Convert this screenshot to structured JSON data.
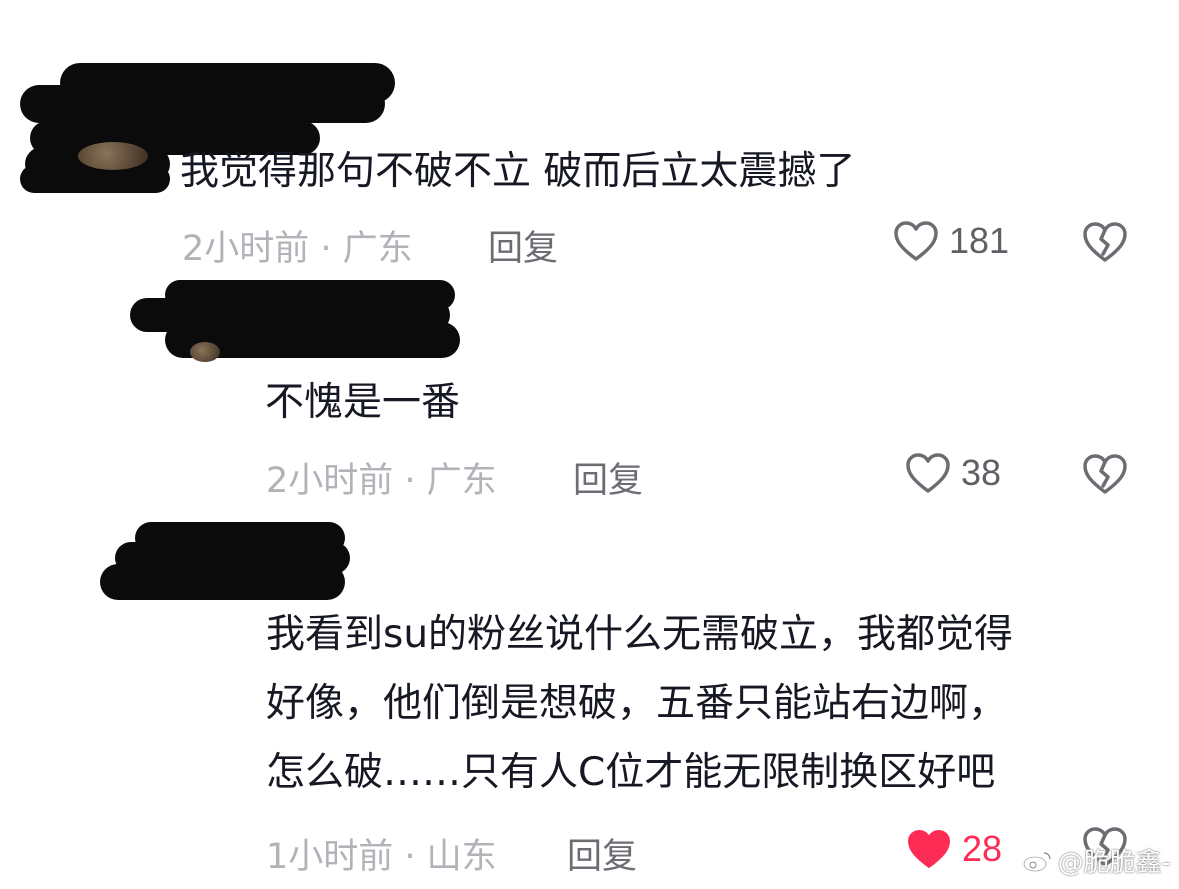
{
  "comments": [
    {
      "text_lines": [
        "我觉得那句不破不立 破而后立太震撼了"
      ],
      "time": "2小时前",
      "location": "广东",
      "reply_label": "回复",
      "likes": "181",
      "liked": false
    },
    {
      "text_lines": [
        "不愧是一番"
      ],
      "time": "2小时前",
      "location": "广东",
      "reply_label": "回复",
      "likes": "38",
      "liked": false
    },
    {
      "text_lines": [
        "我看到su的粉丝说什么无需破立，我都觉得",
        "好像，他们倒是想破，五番只能站右边啊，",
        "怎么破……只有人C位才能无限制换区好吧"
      ],
      "time": "1小时前",
      "location": "山东",
      "reply_label": "回复",
      "likes": "28",
      "liked": true
    }
  ],
  "separator": " · ",
  "colors": {
    "liked_heart": "#fe2c55",
    "text": "#161823",
    "meta": "#b1b3b8",
    "reply": "#6b6d73"
  },
  "icons": {
    "like": "heart-outline-icon",
    "liked": "heart-filled-icon",
    "dislike": "broken-heart-icon"
  },
  "watermark": "@脆脆鑫-"
}
